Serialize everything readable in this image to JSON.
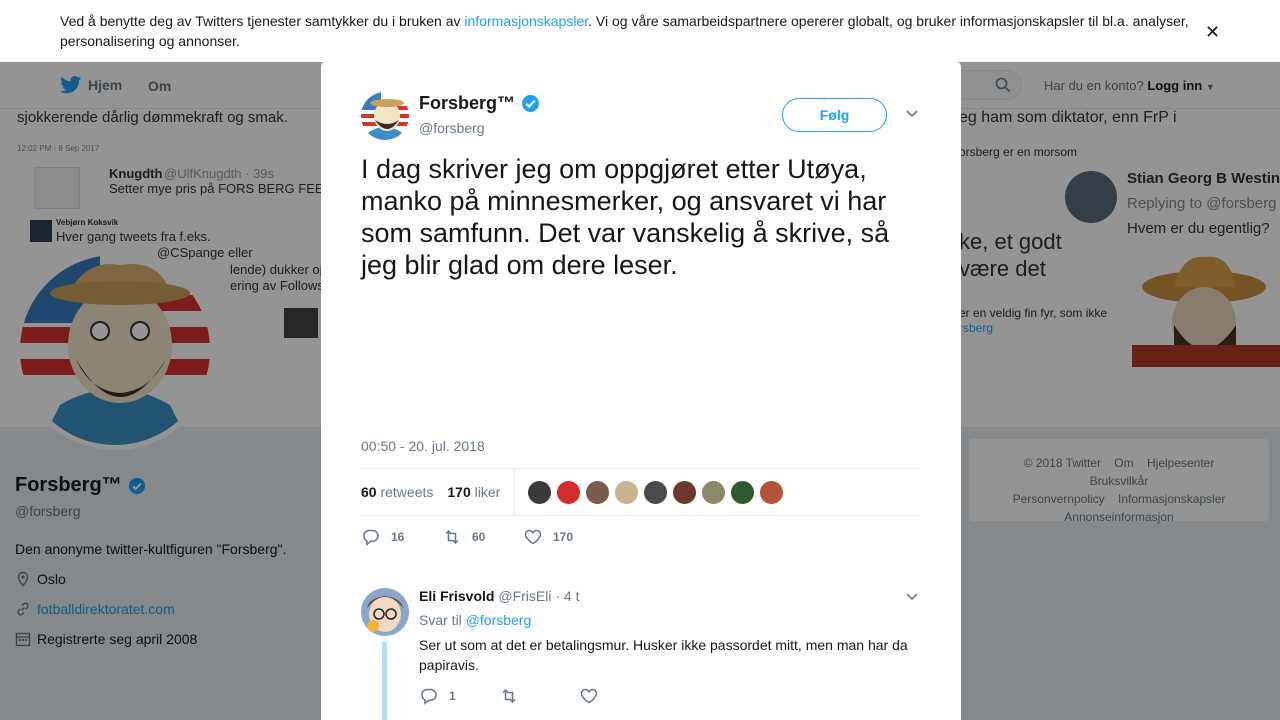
{
  "cookie": {
    "text_before": "Ved å benytte deg av Twitters tjenester samtykker du i bruken av ",
    "link": "informasjonskapsler",
    "text_after": ". Vi og våre samarbeidspartnere opererer globalt, og bruker informasjonskapsler til bl.a. analyser, personalisering og annonser."
  },
  "nav": {
    "home": "Hjem",
    "about": "Om",
    "account_q": "Har du en konto?",
    "login": "Logg inn"
  },
  "banner": {
    "top_left": "sjokkerende dårlig dømmekraft og smak.",
    "timestamp": "12:02 PM · 8 Sep 2017",
    "t1_name": "Knugdth",
    "t1_handle": "@UlfKnugdth · 39s",
    "t1_text": "Setter mye pris på FORS BERG FEED",
    "t2_name": "Vebjørn Koksvik",
    "t2_text": "Hver gang tweets fra f.eks.",
    "t2_text2": "@CSpange eller",
    "t2_text3": "lende) dukker opp i",
    "t2_text4": "ering av Follows.",
    "right_top": "eg ham som diktator, enn FrP i",
    "right_line": "orsberg er en morsom",
    "right_name": "Stian Georg B Westin",
    "right_reply": "Replying to @forsberg",
    "right_q": "Hvem er du egentlig?",
    "right_big1": "ke, et godt",
    "right_big2": "være det",
    "right_small": "er en veldig fin fyr, som ikke",
    "right_small2": "rsberg"
  },
  "profile": {
    "name": "Forsberg™",
    "handle": "@forsberg",
    "bio": "Den anonyme twitter-kultfiguren \"Forsberg\".",
    "location": "Oslo",
    "website": "fotballdirektoratet.com",
    "joined": "Registrerte seg april 2008"
  },
  "footer": {
    "copyright": "© 2018 Twitter",
    "about": "Om",
    "help": "Hjelpesenter",
    "terms": "Bruksvilkår",
    "privacy": "Personvernpolicy",
    "cookies": "Informasjonskapsler",
    "ads": "Annonseinformasjon"
  },
  "tweet": {
    "name": "Forsberg™",
    "handle": "@forsberg",
    "follow": "Følg",
    "text": "I dag skriver jeg om oppgjøret etter Utøya, manko på minnesmerker, og ansvaret vi har som samfunn. Det var vanskelig å skrive, så jeg blir glad om dere leser.",
    "time": "00:50 - 20. jul. 2018",
    "retweets_count": "60",
    "retweets_label": "retweets",
    "likes_count": "170",
    "likes_label": "liker",
    "reply_count": "16",
    "retweet_count": "60",
    "like_count": "170",
    "liker_colors": [
      "#3a3a3a",
      "#d62b2b",
      "#7a5c4a",
      "#c9b58d",
      "#4a4a4a",
      "#6b3a2a",
      "#8a8a6a",
      "#2f5a2f",
      "#b5523a"
    ]
  },
  "reply": {
    "name": "Eli Frisvold",
    "handle": "@FrisEli",
    "time": "· 4 t",
    "reply_to_label": "Svar til",
    "reply_to_handle": "@forsberg",
    "text": "Ser ut som at det er betalingsmur. Husker ikke passordet mitt, men man har da papiravis.",
    "reply_count": "1"
  },
  "colors": {
    "accent": "#1da1f2",
    "overlay": "rgba(0,0,0,0.42)",
    "verified": "#1da1f2"
  }
}
